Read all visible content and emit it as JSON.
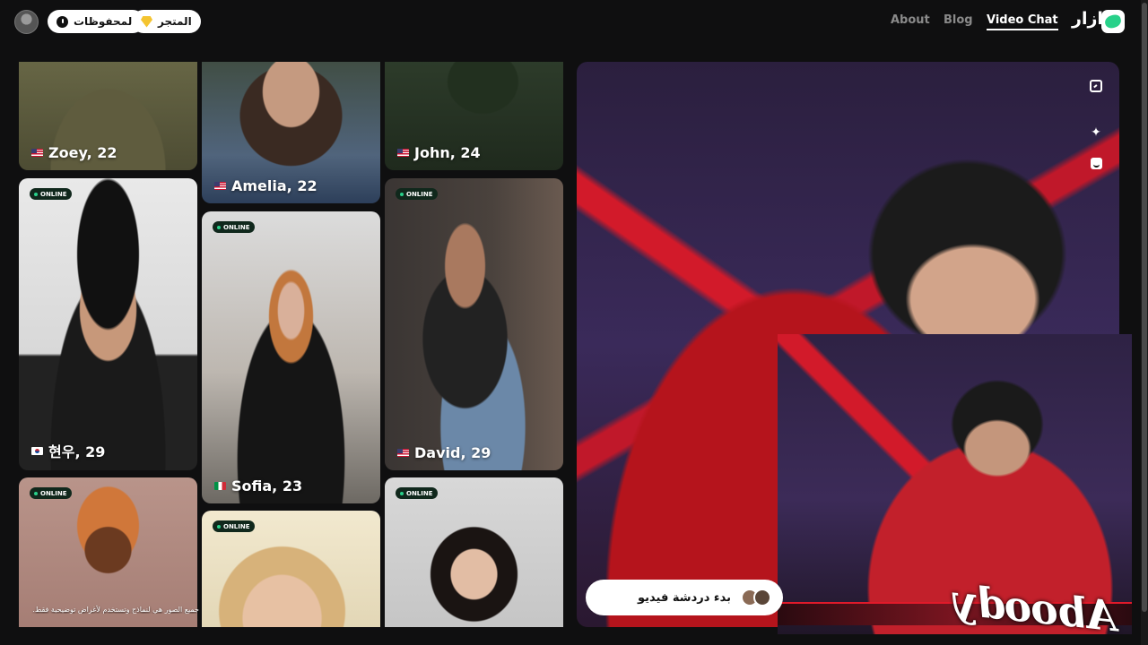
{
  "header": {
    "saved_label": "المحفوظات",
    "store_label": "المتجر",
    "nav": {
      "about": "About",
      "blog": "Blog",
      "video_chat": "Video Chat"
    },
    "brand_name": "ازار"
  },
  "profiles": [
    {
      "name": "Zoey, 22",
      "flag": "us",
      "online": false
    },
    {
      "name": "Amelia, 22",
      "flag": "us",
      "online": false
    },
    {
      "name": "John, 24",
      "flag": "us",
      "online": false
    },
    {
      "name": "현우, 29",
      "flag": "kr",
      "online": true
    },
    {
      "name": "Sofia, 23",
      "flag": "it",
      "online": true
    },
    {
      "name": "David, 29",
      "flag": "us",
      "online": true
    },
    {
      "name": "",
      "flag": "",
      "online": true
    },
    {
      "name": "",
      "flag": "",
      "online": true
    },
    {
      "name": "",
      "flag": "",
      "online": true
    }
  ],
  "badge_label": "ONLINE",
  "disclaimer": "جميع الصور هي لنماذج وتستخدم لأغراض توضيحية فقط.",
  "video": {
    "start_label": "بدء دردشة فيديو",
    "watermark": "Aboody"
  },
  "colors": {
    "accent": "#28d18a",
    "background": "#0f0f10"
  }
}
